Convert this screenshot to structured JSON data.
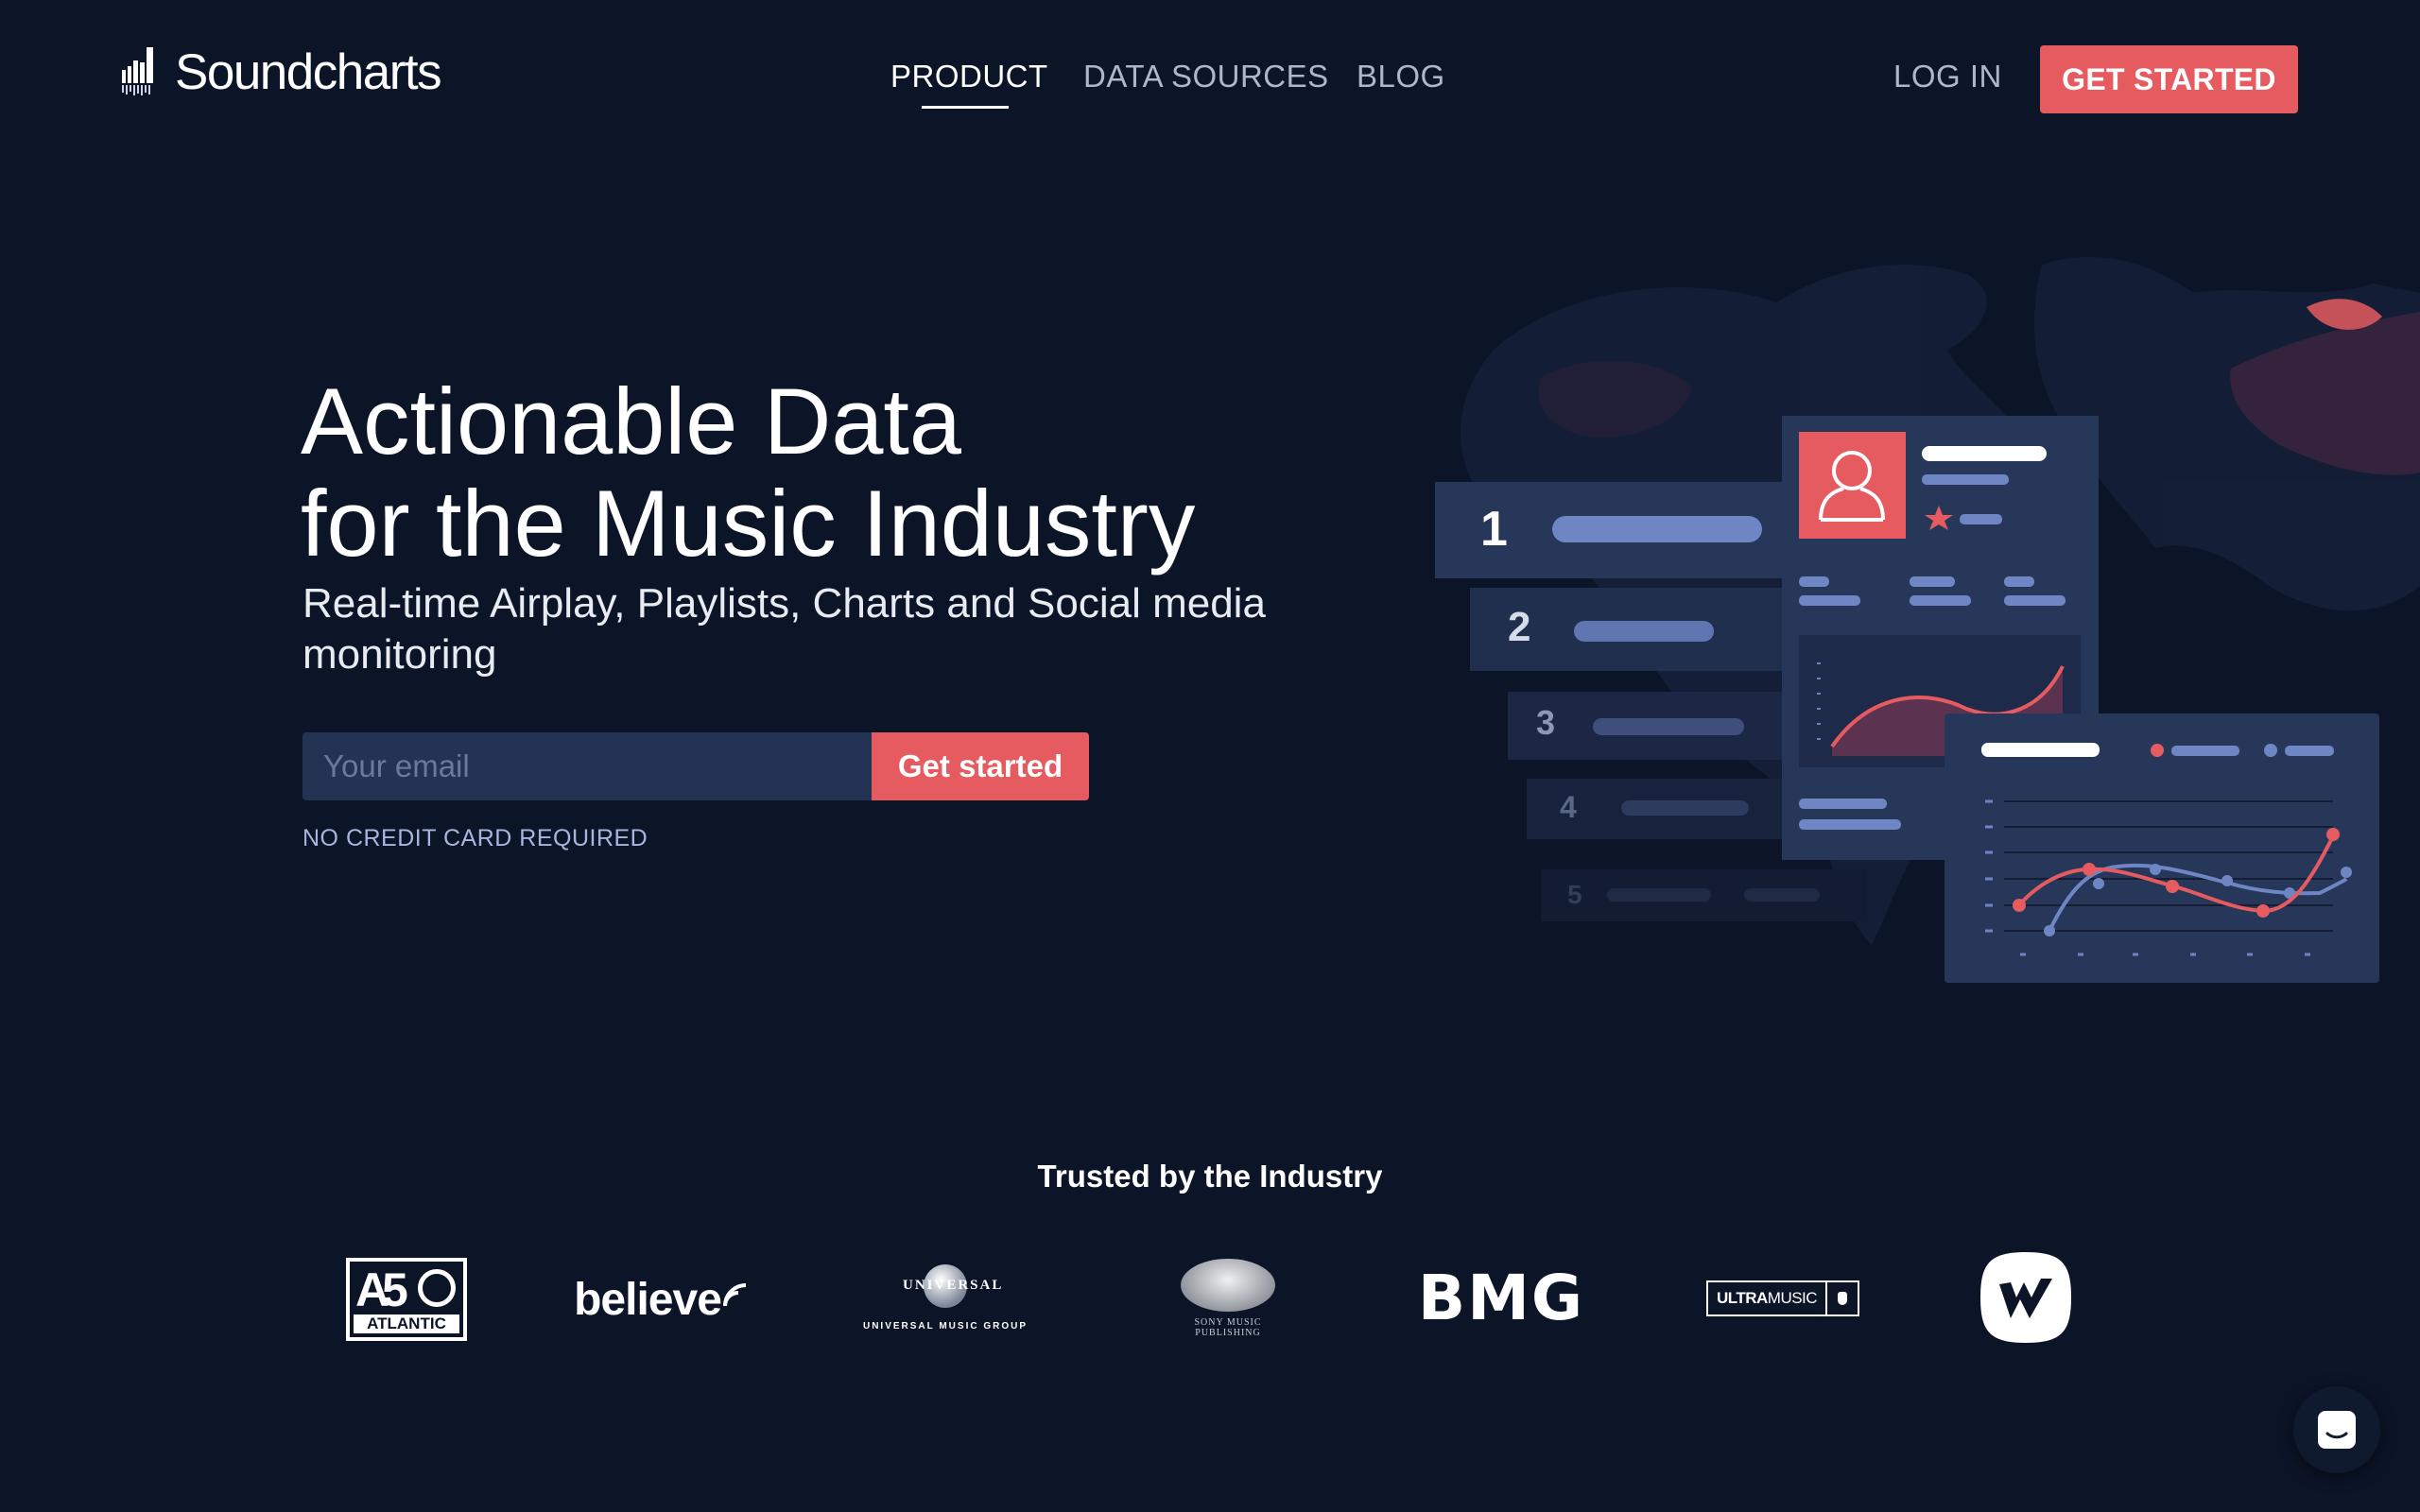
{
  "brand": {
    "name": "Soundcharts"
  },
  "nav": {
    "items": [
      {
        "label": "PRODUCT",
        "active": true
      },
      {
        "label": "DATA SOURCES",
        "active": false
      },
      {
        "label": "BLOG",
        "active": false
      }
    ],
    "login_label": "LOG IN",
    "cta_label": "GET STARTED"
  },
  "hero": {
    "title_line1": "Actionable Data",
    "title_line2": "for the Music Industry",
    "subtitle": "Real-time Airplay, Playlists, Charts and Social media monitoring",
    "email_placeholder": "Your email",
    "cta_label": "Get started",
    "note": "NO CREDIT CARD REQUIRED"
  },
  "illustration": {
    "rank_numbers": [
      "1",
      "2",
      "3",
      "4",
      "5"
    ]
  },
  "trusted": {
    "heading": "Trusted by the Industry",
    "logos": {
      "atlantic": "ATLANTIC",
      "believe": "believe",
      "universal_top": "UNIVERSAL",
      "universal_bottom": "UNIVERSAL MUSIC GROUP",
      "sony_line1": "SONY MUSIC",
      "sony_line2": "PUBLISHING",
      "bmg": "BMG",
      "ultra_bold": "ULTRA",
      "ultra_light": "MUSIC"
    }
  },
  "colors": {
    "background": "#0c1427",
    "accent": "#e55b5f",
    "panel": "#27375a",
    "panel_light": "#6f86c4"
  },
  "icons": {
    "user_card": "user-icon",
    "rating": "star-icon",
    "chat": "chat-icon",
    "map": "world-map-icon"
  }
}
